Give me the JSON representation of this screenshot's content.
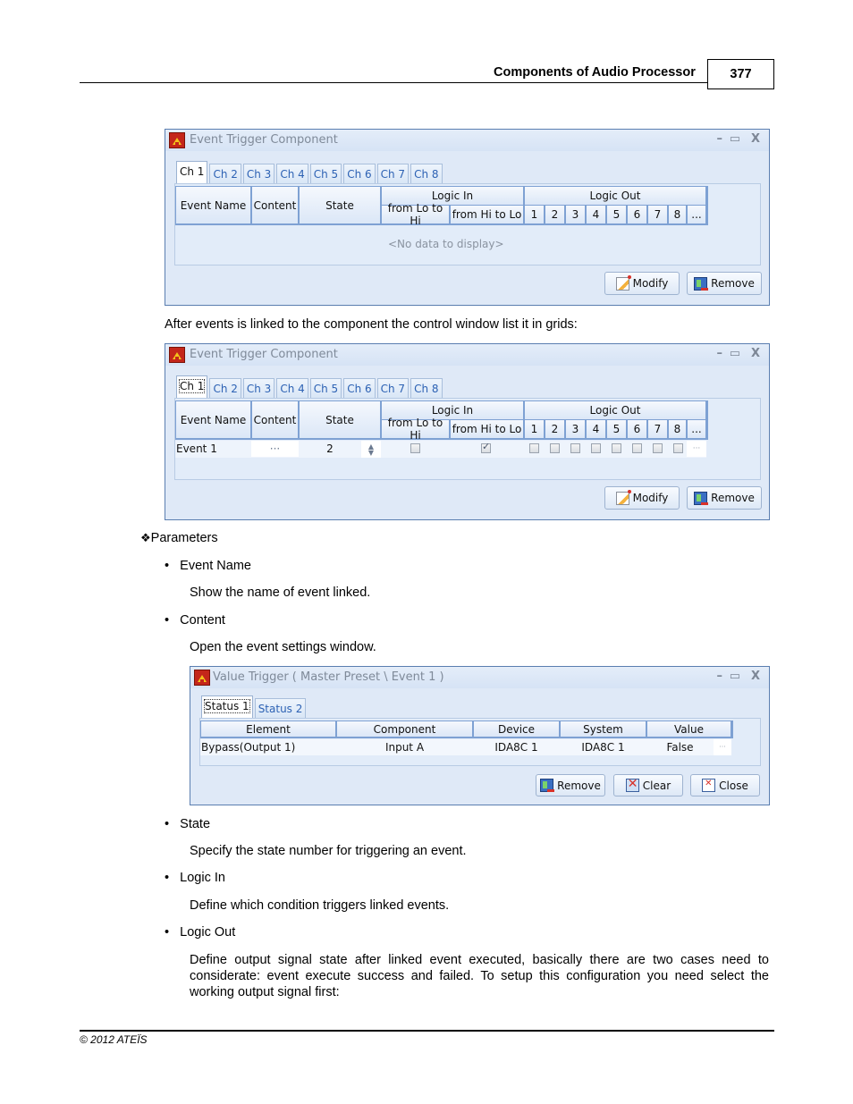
{
  "page_header": {
    "section_title": "Components of Audio Processor",
    "page_number": "377"
  },
  "window1": {
    "title": "Event Trigger Component",
    "controls": {
      "minimize": "–",
      "maximize": "▭",
      "close": "X"
    },
    "tabs": [
      "Ch 1",
      "Ch 2",
      "Ch 3",
      "Ch 4",
      "Ch 5",
      "Ch 6",
      "Ch 7",
      "Ch 8"
    ],
    "active_tab": "Ch 1",
    "columns": {
      "event_name": "Event Name",
      "content": "Content",
      "state": "State",
      "logic_in": "Logic In",
      "logic_in_sub": [
        "from Lo to Hi",
        "from Hi to Lo"
      ],
      "logic_out": "Logic Out",
      "logic_out_sub": [
        "1",
        "2",
        "3",
        "4",
        "5",
        "6",
        "7",
        "8",
        "..."
      ]
    },
    "empty_text": "<No data to display>",
    "buttons": {
      "modify": "Modify",
      "remove": "Remove"
    }
  },
  "caption1": "After events is linked to the component the control window list it in grids:",
  "window2": {
    "title": "Event Trigger Component",
    "controls": {
      "minimize": "–",
      "maximize": "▭",
      "close": "X"
    },
    "tabs": [
      "Ch 1",
      "Ch 2",
      "Ch 3",
      "Ch 4",
      "Ch 5",
      "Ch 6",
      "Ch 7",
      "Ch 8"
    ],
    "active_tab": "Ch 1",
    "columns": {
      "event_name": "Event Name",
      "content": "Content",
      "state": "State",
      "logic_in": "Logic In",
      "logic_in_sub": [
        "from Lo to Hi",
        "from Hi to Lo"
      ],
      "logic_out": "Logic Out",
      "logic_out_sub": [
        "1",
        "2",
        "3",
        "4",
        "5",
        "6",
        "7",
        "8",
        "..."
      ]
    },
    "rows": [
      {
        "event_name": "Event 1",
        "content": "···",
        "state": "2",
        "logic_in": {
          "lo_to_hi": false,
          "hi_to_lo": true
        },
        "logic_out": [
          false,
          false,
          false,
          false,
          false,
          false,
          false,
          false
        ],
        "more": "···"
      }
    ],
    "buttons": {
      "modify": "Modify",
      "remove": "Remove"
    }
  },
  "parameters": {
    "heading": "Parameters",
    "items": [
      {
        "name": "Event Name",
        "desc": "Show the name of event linked."
      },
      {
        "name": "Content",
        "desc": "Open the event settings window."
      },
      {
        "name": "State",
        "desc": "Specify the state number for triggering an event."
      },
      {
        "name": "Logic In",
        "desc": "Define which condition triggers linked events."
      },
      {
        "name": "Logic Out",
        "desc": "Define output signal state after linked event executed, basically there are two cases need to considerate: event execute success and failed. To setup this configuration you need select the working output signal first:"
      }
    ]
  },
  "window3": {
    "title": "Value Trigger ( Master Preset \\ Event 1 )",
    "controls": {
      "minimize": "–",
      "maximize": "▭",
      "close": "X"
    },
    "tabs": [
      "Status 1",
      "Status 2"
    ],
    "active_tab": "Status 1",
    "columns": [
      "Element",
      "Component",
      "Device",
      "System",
      "Value"
    ],
    "rows": [
      {
        "element": "Bypass(Output 1)",
        "component": "Input A",
        "device": "IDA8C 1",
        "system": "IDA8C 1",
        "value": "False",
        "more": "···"
      }
    ],
    "buttons": {
      "remove": "Remove",
      "clear": "Clear",
      "close": "Close"
    }
  },
  "footer": {
    "copyright": "© 2012 ATEÏS"
  }
}
